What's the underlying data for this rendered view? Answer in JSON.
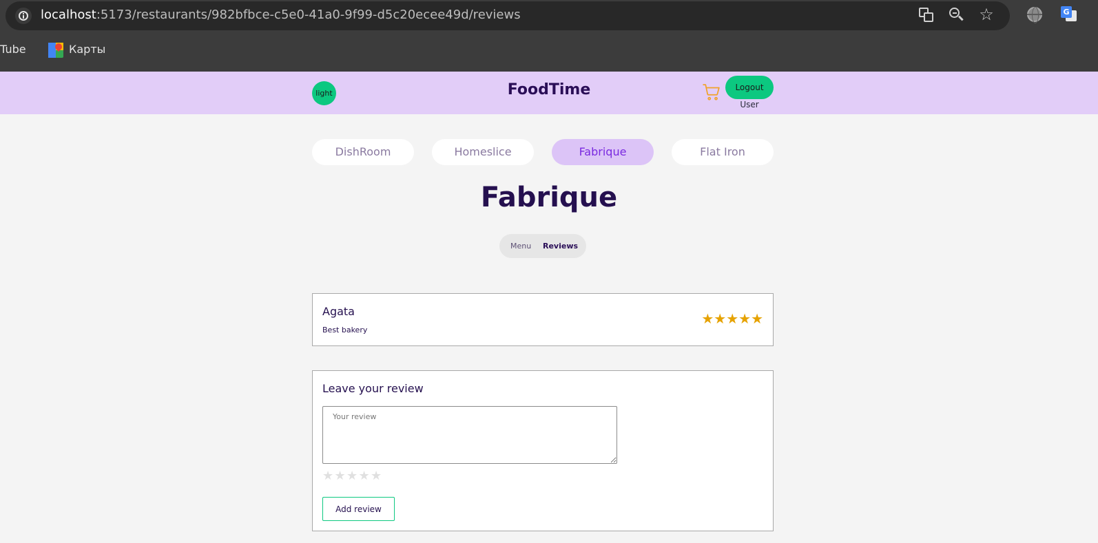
{
  "browser": {
    "url_host": "localhost",
    "url_path": ":5173/restaurants/982bfbce-c5e0-41a0-9f99-d5c20ecee49d/reviews",
    "bookmarks": [
      {
        "label": "uTube"
      },
      {
        "label": "Карты"
      }
    ]
  },
  "header": {
    "theme_label": "light",
    "brand": "FoodTime",
    "logout_label": "Logout",
    "user_label": "User",
    "cart_color": "#f0a22b"
  },
  "restaurant_tabs": [
    {
      "label": "DishRoom",
      "active": false
    },
    {
      "label": "Homeslice",
      "active": false
    },
    {
      "label": "Fabrique",
      "active": true
    },
    {
      "label": "Flat Iron",
      "active": false
    }
  ],
  "restaurant": {
    "title": "Fabrique",
    "subtabs": {
      "menu": "Menu",
      "reviews": "Reviews",
      "active": "Reviews"
    }
  },
  "reviews": [
    {
      "author": "Agata",
      "text": "Best bakery",
      "rating": 5,
      "stars": "★★★★★"
    }
  ],
  "review_form": {
    "title": "Leave your review",
    "placeholder": "Your review",
    "rating": 0,
    "star_glyph": "★",
    "submit_label": "Add review"
  },
  "colors": {
    "accent_green": "#0cc880",
    "header_bg": "#e2cdf8",
    "active_tab_bg": "#dcc4f7",
    "title_color": "#25104f",
    "star_filled": "#e6a200",
    "star_empty": "#e0e0e0"
  }
}
